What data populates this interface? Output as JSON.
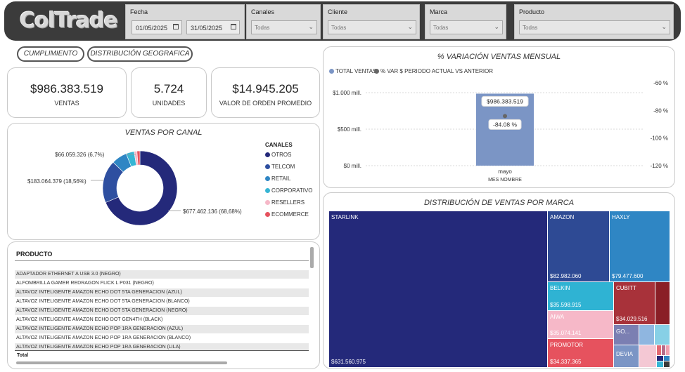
{
  "header": {
    "logo": "ColTrade",
    "fecha_label": "Fecha",
    "date_from": "01/05/2025",
    "date_to": "31/05/2025",
    "filters": [
      {
        "label": "Canales",
        "value": "Todas"
      },
      {
        "label": "Cliente",
        "value": "Todas"
      },
      {
        "label": "Marca",
        "value": "Todas"
      },
      {
        "label": "Producto",
        "value": "Todas"
      }
    ]
  },
  "nav": {
    "cumplimiento": "CUMPLIMIENTO",
    "distribucion": "DISTRIBUCIÓN GEOGRAFICA"
  },
  "kpis": {
    "ventas_value": "$986.383.519",
    "ventas_label": "VENTAS",
    "unidades_value": "5.724",
    "unidades_label": "UNIDADES",
    "orden_value": "$14.945.205",
    "orden_label": "VALOR DE ORDEN PROMEDIO"
  },
  "canal": {
    "title": "VENTAS POR CANAL",
    "legend_title": "CANALES",
    "labels": {
      "otros": "$677.462.136 (68,68%)",
      "telcom": "$183.064.379 (18,56%)",
      "retail": "$66.059.326 (6,7%)"
    },
    "colors": {
      "OTROS": "#24297a",
      "TELCOM": "#2e4fa0",
      "RETAIL": "#2f86c4",
      "CORPORATIVO": "#37b5d4",
      "RESELLERS": "#f6b8c8",
      "ECOMMERCE": "#e6525e"
    }
  },
  "variacion": {
    "title": "% VARIACIÓN VENTAS MENSUAL",
    "legend_total": "TOTAL VENTAS",
    "legend_var": "% VAR $ PERIODO ACTUAL VS ANTERIOR",
    "bar_label": "$986.383.519",
    "point_label": "-84.08 %",
    "x_title": "MES NOMBRE",
    "colors": {
      "bar": "#7b95c5",
      "point": "#666666"
    }
  },
  "productos": {
    "header": "PRODUCTO",
    "items": [
      "ADAPTADOR ETHERNET A USB 3.0 (NEGRO)",
      "ALFOMBRILLA GAMER REDRAGON FLICK L P031 (NEGRO)",
      "ALTAVOZ INTELIGENTE AMAZON ECHO DOT 5TA GENERACION (AZUL)",
      "ALTAVOZ INTELIGENTE AMAZON ECHO DOT 5TA GENERACION (BLANCO)",
      "ALTAVOZ INTELIGENTE AMAZON ECHO DOT 5TA GENERACION (NEGRO)",
      "ALTAVOZ INTELIGENTE AMAZON ECHO DOT GEN4TH (BLACK)",
      "ALTAVOZ INTELIGENTE AMAZON ECHO POP 1RA GENERACION (AZUL)",
      "ALTAVOZ INTELIGENTE AMAZON ECHO POP 1RA GENERACION (BLANCO)",
      "ALTAVOZ INTELIGENTE AMAZON ECHO POP 1RA GENERACION (LILA)"
    ],
    "total_label": "Total"
  },
  "marca": {
    "title": "DISTRIBUCIÓN DE VENTAS POR MARCA",
    "tiles": {
      "starlink": {
        "name": "STARLINK",
        "value": "$631.560.975",
        "color": "#24297a"
      },
      "amazon": {
        "name": "AMAZON",
        "value": "$82.982.060",
        "color": "#2e4a94"
      },
      "haxly": {
        "name": "HAXLY",
        "value": "$79.477.600",
        "color": "#2f86c4"
      },
      "belkin": {
        "name": "BELKIN",
        "value": "$35.598.915",
        "color": "#2fb3d3"
      },
      "cubitt": {
        "name": "CUBITT",
        "value": "$34.029.516",
        "color": "#a8323a"
      },
      "aiwa": {
        "name": "AIWA",
        "value": "$35.074.141",
        "color": "#f6b8c8"
      },
      "promotor": {
        "name": "PROMOTOR",
        "value": "$34.337.365",
        "color": "#e6525e"
      },
      "go": {
        "name": "GO...",
        "color": "#7b7fb2"
      },
      "devia": {
        "name": "DEVIA",
        "color": "#7b95c5"
      }
    }
  },
  "chart_data": [
    {
      "type": "pie",
      "title": "VENTAS POR CANAL",
      "categories": [
        "OTROS",
        "TELCOM",
        "RETAIL",
        "CORPORATIVO",
        "RESELLERS",
        "ECOMMERCE"
      ],
      "values": [
        677462136,
        183064379,
        66059326,
        35000000,
        12000000,
        12797678
      ],
      "legend": "right"
    },
    {
      "type": "bar",
      "title": "% VARIACIÓN VENTAS MENSUAL",
      "categories": [
        "mayo"
      ],
      "series": [
        {
          "name": "TOTAL VENTAS",
          "values": [
            986383519
          ]
        },
        {
          "name": "% VAR $ PERIODO ACTUAL VS ANTERIOR",
          "values": [
            -84.08
          ]
        }
      ],
      "xlabel": "MES NOMBRE",
      "y_ticks": [
        "$1.000 mill.",
        "$500 mill.",
        "$0 mill."
      ],
      "y2_ticks": [
        "-60 %",
        "-80 %",
        "-100 %",
        "-120 %"
      ],
      "ylim": [
        0,
        1000000000
      ],
      "y2lim": [
        -120,
        -60
      ],
      "legend": "top-left"
    }
  ]
}
